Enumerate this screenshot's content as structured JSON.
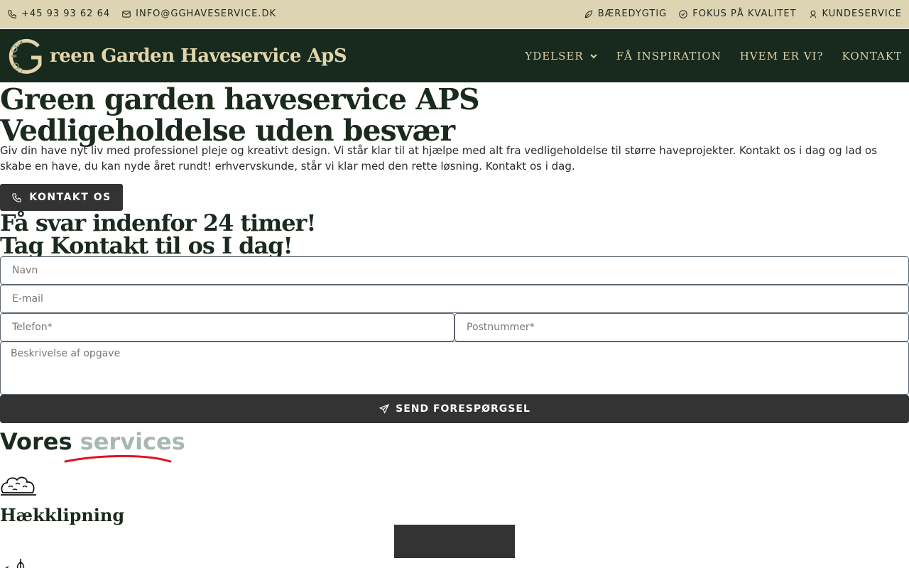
{
  "topbar": {
    "phone": "+45 93 93 62 64",
    "email": "INFO@GGHAVESERVICE.DK",
    "badges": [
      "BÆREDYGTIG",
      "FOKUS PÅ KVALITET",
      "KUNDESERVICE"
    ]
  },
  "header": {
    "logo_text": "reen Garden Haveservice ApS",
    "nav": [
      "YDELSER",
      "FÅ INSPIRATION",
      "HVEM ER VI?",
      "KONTAKT"
    ]
  },
  "hero": {
    "title_line1": "Green garden haveservice APS",
    "title_line2": "Vedligeholdelse uden besvær",
    "text": "Giv din have nyt liv med professionel pleje og kreativt design. Vi står klar til at hjælpe med alt fra vedligeholdelse til større haveprojekter. Kontakt os i dag og lad os skabe en have, du kan nyde året rundt! erhvervskunde, står vi klar med den rette løsning. Kontakt os i dag.",
    "button": "KONTAKT OS"
  },
  "form": {
    "title_line1": "Få svar indenfor 24 timer!",
    "title_line2": "Tag Kontakt til os I dag!",
    "placeholders": {
      "name": "Navn",
      "email": "E-mail",
      "phone": "Telefon*",
      "zip": "Postnummer*",
      "description": "Beskrivelse af opgave"
    },
    "submit": "SEND FORESPØRGSEL"
  },
  "services": {
    "title_part1": "Vores",
    "title_part2": "services",
    "items": [
      "Hækklipning"
    ]
  },
  "colors": {
    "topbar_bg": "#ddd4b3",
    "header_bg": "#172a1d",
    "logo_gold": "#e2d4ab",
    "button_dark": "#333333",
    "accent_red": "#e0141e"
  }
}
